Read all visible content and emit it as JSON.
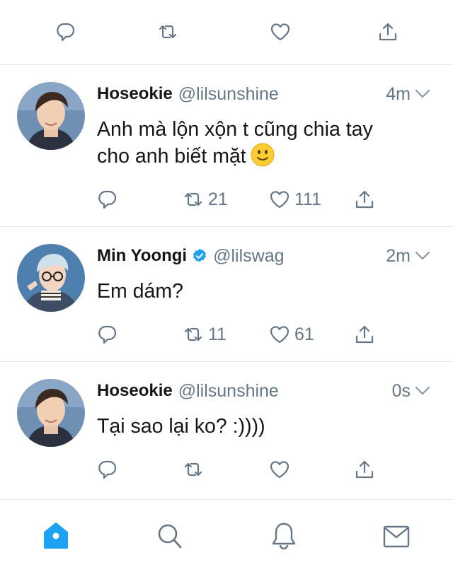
{
  "top_actions": {
    "icons": [
      "reply-icon",
      "retweet-icon",
      "like-icon",
      "share-icon"
    ]
  },
  "tweets": [
    {
      "name": "Hoseokie",
      "handle": "@lilsunshine",
      "time": "4m",
      "verified": false,
      "text_line1": "Anh mà lộn xộn t cũng chia tay",
      "text_line2": "cho anh biết mặt",
      "emoji": "slightly-smiling-face",
      "retweets": "21",
      "likes": "111"
    },
    {
      "name": "Min Yoongi",
      "handle": "@lilswag",
      "time": "2m",
      "verified": true,
      "text": "Em dám?",
      "retweets": "11",
      "likes": "61"
    },
    {
      "name": "Hoseokie",
      "handle": "@lilsunshine",
      "time": "0s",
      "verified": false,
      "text": "Tại sao lại ko? :))))",
      "retweets": "",
      "likes": ""
    }
  ],
  "tabbar": {
    "tabs": [
      "home-icon",
      "search-icon",
      "notifications-icon",
      "messages-icon"
    ],
    "active": "home-icon"
  },
  "colors": {
    "accent": "#1da1f2",
    "icon_gray": "#657786",
    "text": "#14171a",
    "divider": "#e1e8ed"
  }
}
